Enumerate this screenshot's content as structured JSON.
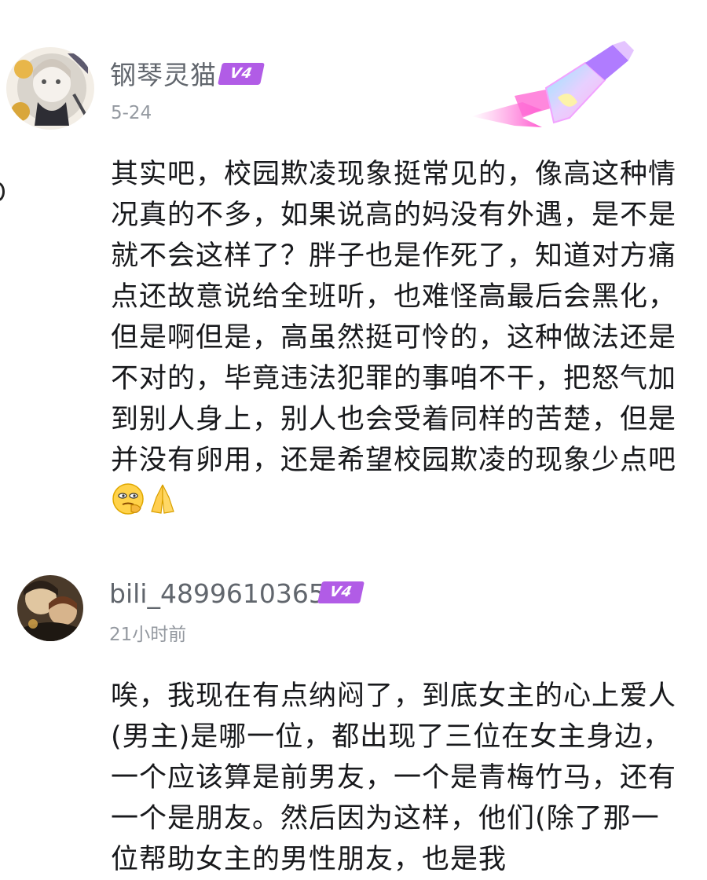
{
  "comments": [
    {
      "username": "钢琴灵猫",
      "level": "V4",
      "time": "5-24",
      "content": "其实吧，校园欺凌现象挺常见的，像高这种情况真的不多，如果说高的妈没有外遇，是不是就不会这样了？胖子也是作死了，知道对方痛点还故意说给全班听，也难怪高最后会黑化，但是啊但是，高虽然挺可怜的，这种做法还是不对的，毕竟违法犯罪的事咱不干，把怒气加到别人身上，别人也会受着同样的苦楚，但是并没有卵用，还是希望校园欺凌的现象少点吧",
      "emojis": [
        "thinking-face-emoji",
        "folded-hands-emoji"
      ]
    },
    {
      "username": "bili_48996103650",
      "level": "V4",
      "time": "21小时前",
      "content": "唉，我现在有点纳闷了，到底女主的心上爱人(男主)是哪一位，都出现了三位在女主身边，一个应该算是前男友，一个是青梅竹马，还有一个是朋友。然后因为这样，他们(除了那一位帮助女主的男性朋友，也是我"
    }
  ],
  "colors": {
    "username": "#61666d",
    "timestamp": "#9499a0",
    "level_badge": "#b15ce6",
    "text": "#18191c"
  }
}
